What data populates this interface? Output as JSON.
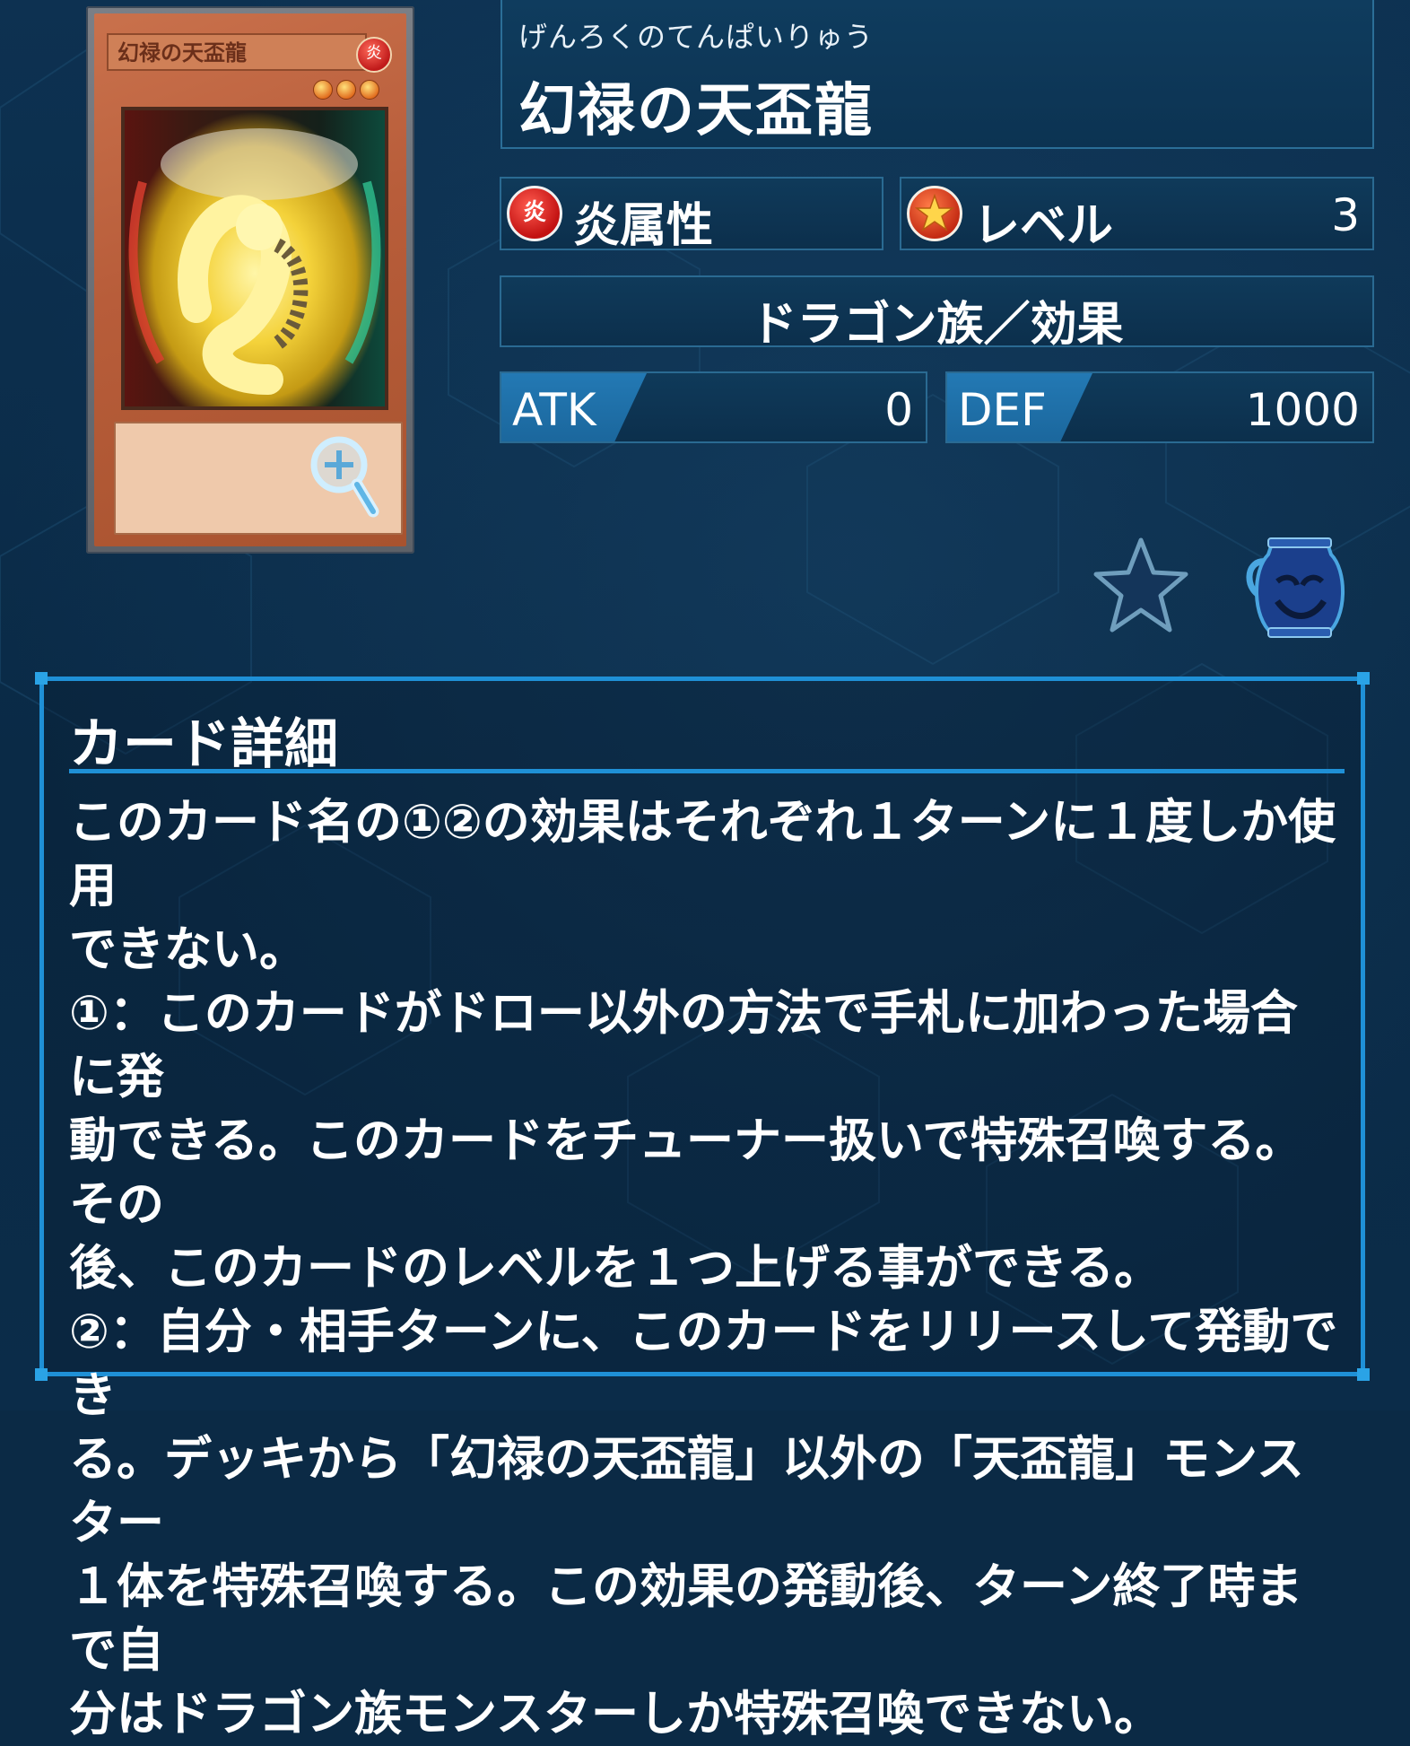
{
  "card": {
    "furigana": "げんろくのてんぱいりゅう",
    "name": "幻禄の天盃龍",
    "image": {
      "name_plate": "幻禄の天盃龍",
      "attribute_glyph": "炎",
      "level_stars": 3
    },
    "attribute": {
      "icon": "fire-attribute-icon",
      "glyph": "炎",
      "label": "炎属性",
      "color": "#c21111"
    },
    "level": {
      "icon": "level-star-icon",
      "label": "レベル",
      "value": "3"
    },
    "type": "ドラゴン族／効果",
    "atk": {
      "label": "ATK",
      "value": "0"
    },
    "def": {
      "label": "DEF",
      "value": "1000"
    }
  },
  "actions": {
    "zoom_icon": "zoom-in-icon",
    "favorite_icon": "star-icon",
    "pot_icon": "pot-of-greed-icon"
  },
  "details": {
    "heading": "カード詳細",
    "text": "このカード名の①②の効果はそれぞれ１ターンに１度しか使用\nできない。\n①：このカードがドロー以外の方法で手札に加わった場合に発\n動できる。このカードをチューナー扱いで特殊召喚する。その\n後、このカードのレベルを１つ上げる事ができる。\n②：自分・相手ターンに、このカードをリリースして発動でき\nる。デッキから「幻禄の天盃龍」以外の「天盃龍」モンスター\n１体を特殊召喚する。この効果の発動後、ターン終了時まで自\n分はドラゴン族モンスターしか特殊召喚できない。"
  },
  "colors": {
    "background": "#0b2a45",
    "panel_border": "#2a6a92",
    "accent_blue": "#1f90d6",
    "stat_tab": "#2379b4"
  }
}
